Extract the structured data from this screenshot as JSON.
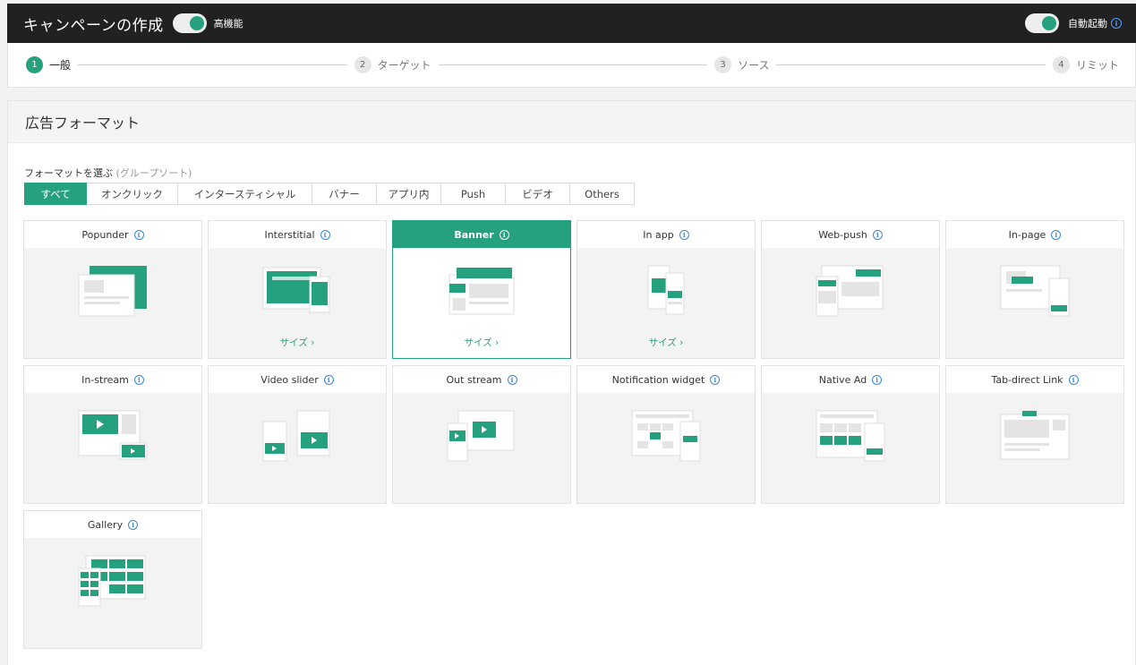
{
  "header": {
    "title": "キャンペーンの作成",
    "advanced_label": "高機能",
    "auto_label": "自動起動"
  },
  "steps": [
    {
      "num": "1",
      "label": "一般",
      "active": true
    },
    {
      "num": "2",
      "label": "ターゲット",
      "active": false
    },
    {
      "num": "3",
      "label": "ソース",
      "active": false
    },
    {
      "num": "4",
      "label": "リミット",
      "active": false
    }
  ],
  "panel": {
    "title": "広告フォーマット",
    "choose_label": "フォーマットを選ぶ",
    "choose_hint": "(グループソート)"
  },
  "filters": [
    {
      "label": "すべて",
      "active": true
    },
    {
      "label": "オンクリック",
      "active": false
    },
    {
      "label": "インタースティシャル",
      "active": false
    },
    {
      "label": "バナー",
      "active": false
    },
    {
      "label": "アプリ内",
      "active": false
    },
    {
      "label": "Push",
      "active": false
    },
    {
      "label": "ビデオ",
      "active": false
    },
    {
      "label": "Others",
      "active": false
    }
  ],
  "formats": [
    {
      "name": "Popunder",
      "size": "",
      "icon": "popunder-icon",
      "selected": false
    },
    {
      "name": "Interstitial",
      "size": "サイズ ›",
      "icon": "interstitial-icon",
      "selected": false
    },
    {
      "name": "Banner",
      "size": "サイズ ›",
      "icon": "banner-icon",
      "selected": true
    },
    {
      "name": "In app",
      "size": "サイズ ›",
      "icon": "in-app-icon",
      "selected": false
    },
    {
      "name": "Web-push",
      "size": "",
      "icon": "web-push-icon",
      "selected": false
    },
    {
      "name": "In-page",
      "size": "",
      "icon": "in-page-icon",
      "selected": false
    },
    {
      "name": "In-stream",
      "size": "",
      "icon": "in-stream-icon",
      "selected": false
    },
    {
      "name": "Video slider",
      "size": "",
      "icon": "video-slider-icon",
      "selected": false
    },
    {
      "name": "Out stream",
      "size": "",
      "icon": "out-stream-icon",
      "selected": false
    },
    {
      "name": "Notification widget",
      "size": "",
      "icon": "notification-widget-icon",
      "selected": false
    },
    {
      "name": "Native Ad",
      "size": "",
      "icon": "native-ad-icon",
      "selected": false
    },
    {
      "name": "Tab-direct Link",
      "size": "",
      "icon": "tab-direct-link-icon",
      "selected": false
    },
    {
      "name": "Gallery",
      "size": "",
      "icon": "gallery-icon",
      "selected": false
    }
  ],
  "colors": {
    "accent": "#26a17f",
    "header_bg": "#212121",
    "info": "#3b86d6"
  }
}
